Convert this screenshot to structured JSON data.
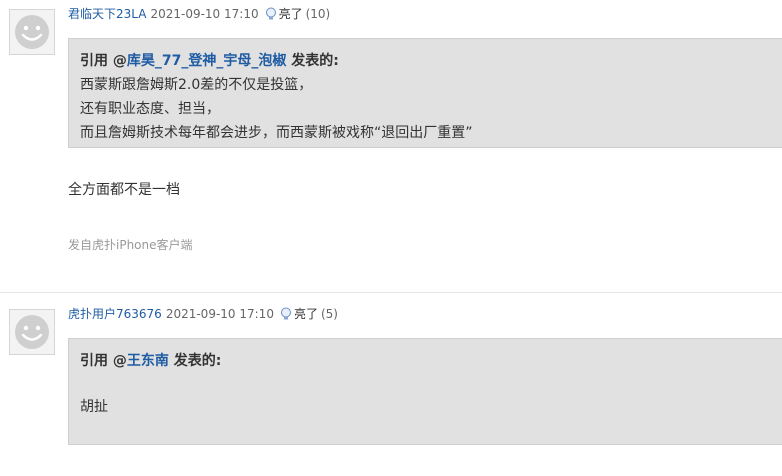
{
  "posts": [
    {
      "username": "君临天下23LA",
      "time": "2021-09-10 17:10",
      "light_label": "亮了",
      "light_count": "(10)",
      "quote": {
        "prefix": "引用 @",
        "user": "库昊_77_登神_宇母_泡椒",
        "suffix": " 发表的:",
        "lines": [
          "西蒙斯跟詹姆斯2.0差的不仅是投篮，",
          "还有职业态度、担当，",
          "而且詹姆斯技术每年都会进步，而西蒙斯被戏称“退回出厂重置”"
        ]
      },
      "reply": "全方面都不是一档",
      "source": "发自虎扑iPhone客户端"
    },
    {
      "username": "虎扑用户763676",
      "time": "2021-09-10 17:10",
      "light_label": "亮了",
      "light_count": "(5)",
      "quote": {
        "prefix": "引用 @",
        "user": "王东南",
        "suffix": " 发表的:",
        "lines": [
          "胡扯"
        ]
      }
    }
  ]
}
